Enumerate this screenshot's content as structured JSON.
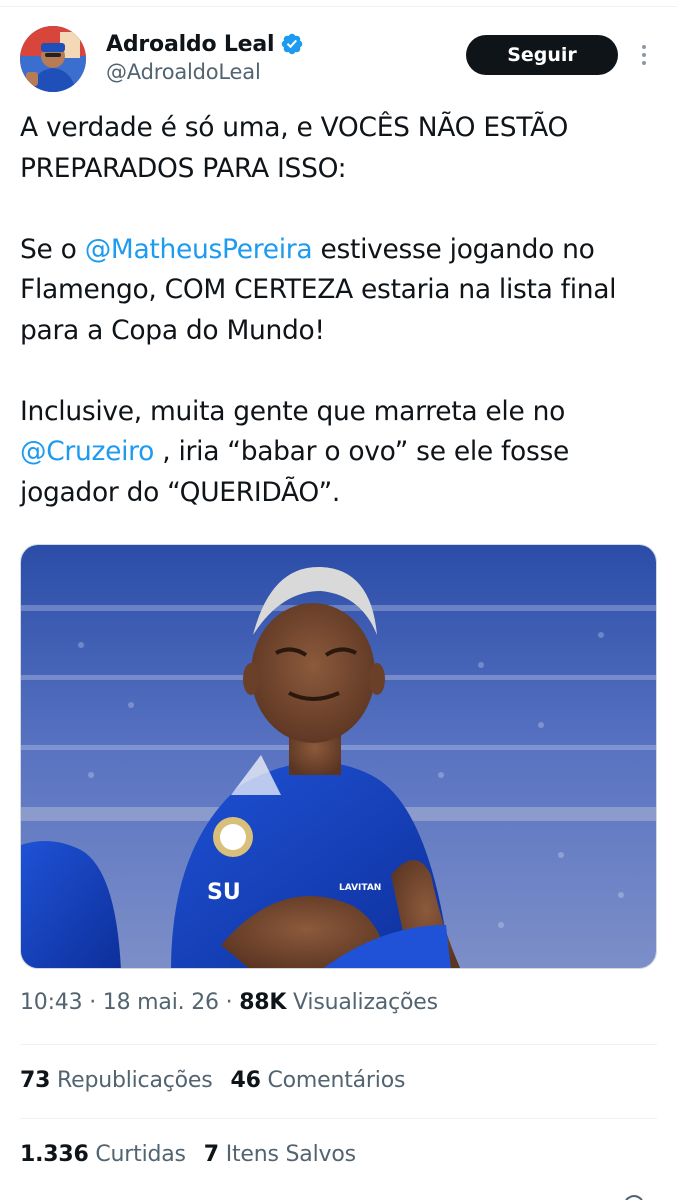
{
  "user": {
    "display_name": "Adroaldo Leal",
    "handle": "@AdroaldoLeal",
    "verified_icon": "verified-badge-icon",
    "follow_label": "Seguir",
    "more_icon": "more-vertical-icon"
  },
  "tweet": {
    "p1": "A verdade é só uma, e VOCÊS NÃO ESTÃO PREPARADOS PARA ISSO:",
    "p2_before": "Se o ",
    "p2_mention": "@MatheusPereira",
    "p2_after": " estivesse jogando no Flamengo, COM CERTEZA estaria na lista final para a Copa do Mundo!",
    "p3_before": "Inclusive, muita gente que marreta ele no ",
    "p3_mention": "@Cruzeiro",
    "p3_after": " , iria “babar o ovo” se ele fosse jogador do “QUERIDÃO”."
  },
  "media": {
    "jersey_sponsor": "LAVITAN",
    "jersey_chest": "SU"
  },
  "meta": {
    "time": "10:43",
    "sep1": " · ",
    "date": "18 mai. 26",
    "sep2": " · ",
    "views_count": "88K",
    "views_label": " Visualizações"
  },
  "stats": {
    "reposts_count": "73",
    "reposts_label": " Republicações",
    "comments_count": "46",
    "comments_label": " Comentários",
    "likes_count": "1.336",
    "likes_label": " Curtidas",
    "saves_count": "7",
    "saves_label": " Itens Salvos"
  },
  "colors": {
    "link": "#1d9bf0",
    "verified": "#1d9bf0",
    "primary_text": "#0f1419",
    "secondary_text": "#536471",
    "follow_bg": "#0f1419"
  }
}
